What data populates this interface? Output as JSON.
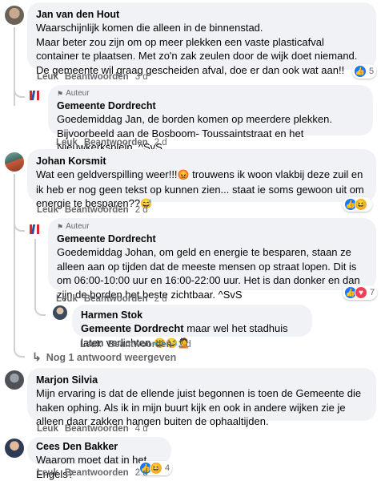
{
  "labels": {
    "like": "Leuk",
    "reply": "Beantwoorden",
    "author_badge": "Auteur",
    "dot": "·"
  },
  "comments": [
    {
      "author": "Jan van den Hout",
      "text": "Waarschijnlijk komen die alleen in de binnenstad.\nMaar beter zou zijn om op meer plekken een vaste plasticafval container te plaatsen. Met zo'n zak zeulen door de wijk doet niemand. De gemeente wil graag gescheiden afval, doe er dan ook wat aan!!",
      "time": "3 d",
      "reactions": {
        "count": "5",
        "types": [
          "like"
        ]
      },
      "replies": [
        {
          "author": "Gemeente Dordrecht",
          "is_author": true,
          "text": "Goedemiddag Jan, de borden komen op meerdere plekken. Bijvoorbeeld aan de Bosboom- Toussaintstraat en het Nieuwkerksplein. ^SvS",
          "time": "2 d"
        }
      ]
    },
    {
      "author": "Johan Korsmit",
      "text_parts": [
        "Wat een geldverspilling weer!!!",
        " trouwens ik woon vlakbij deze zuil en ik heb er nog geen tekst op kunnen zien... staat ie soms gewoon uit om energie te besparen??"
      ],
      "emojis": [
        "angry-emoji",
        "grin-sweat-emoji"
      ],
      "time": "2 d",
      "reactions": {
        "count": "",
        "types": [
          "like",
          "haha"
        ]
      },
      "replies": [
        {
          "author": "Gemeente Dordrecht",
          "is_author": true,
          "text": "Goedemiddag Johan, om geld en energie te besparen, staan ze alleen aan op tijden dat de meeste mensen op straat lopen. Dit is om 06:00-10:00 uur en 16:00-22:00 uur. Het is dan donker en dan zijn de borden het beste zichtbaar. ^SvS",
          "time": "2 d",
          "reactions": {
            "count": "7",
            "types": [
              "like",
              "love"
            ]
          }
        },
        {
          "author": "Harmen Stok",
          "mention": "Gemeente Dordrecht",
          "text": " maar wel het stadhuis laten verlichten ",
          "emojis": [
            "laughing-emoji",
            "laughing-emoji",
            "facepalm-emoji"
          ],
          "time": "2 d"
        }
      ],
      "more_replies": "Nog 1 antwoord weergeven"
    },
    {
      "author": "Marjon Silvia",
      "text": "Mijn ervaring is dat de ellende juist begonnen is toen de Gemeente die haken ophing. Als ik in mijn buurt kijk en ook in andere wijken zie je alleen daar zakken hangen buiten de ophaaltijden.",
      "time": "4 u"
    },
    {
      "author": "Cees Den Bakker",
      "text": "Waarom moet dat in het Engels?",
      "time": "2 d",
      "reactions": {
        "count": "4",
        "types": [
          "like",
          "haha"
        ]
      }
    }
  ],
  "colors": {
    "bubble": "#f0f2f5",
    "meta": "#65676b",
    "like": "#1877f2",
    "muni_red": "#d7282f",
    "muni_blue": "#2a4f9e"
  }
}
